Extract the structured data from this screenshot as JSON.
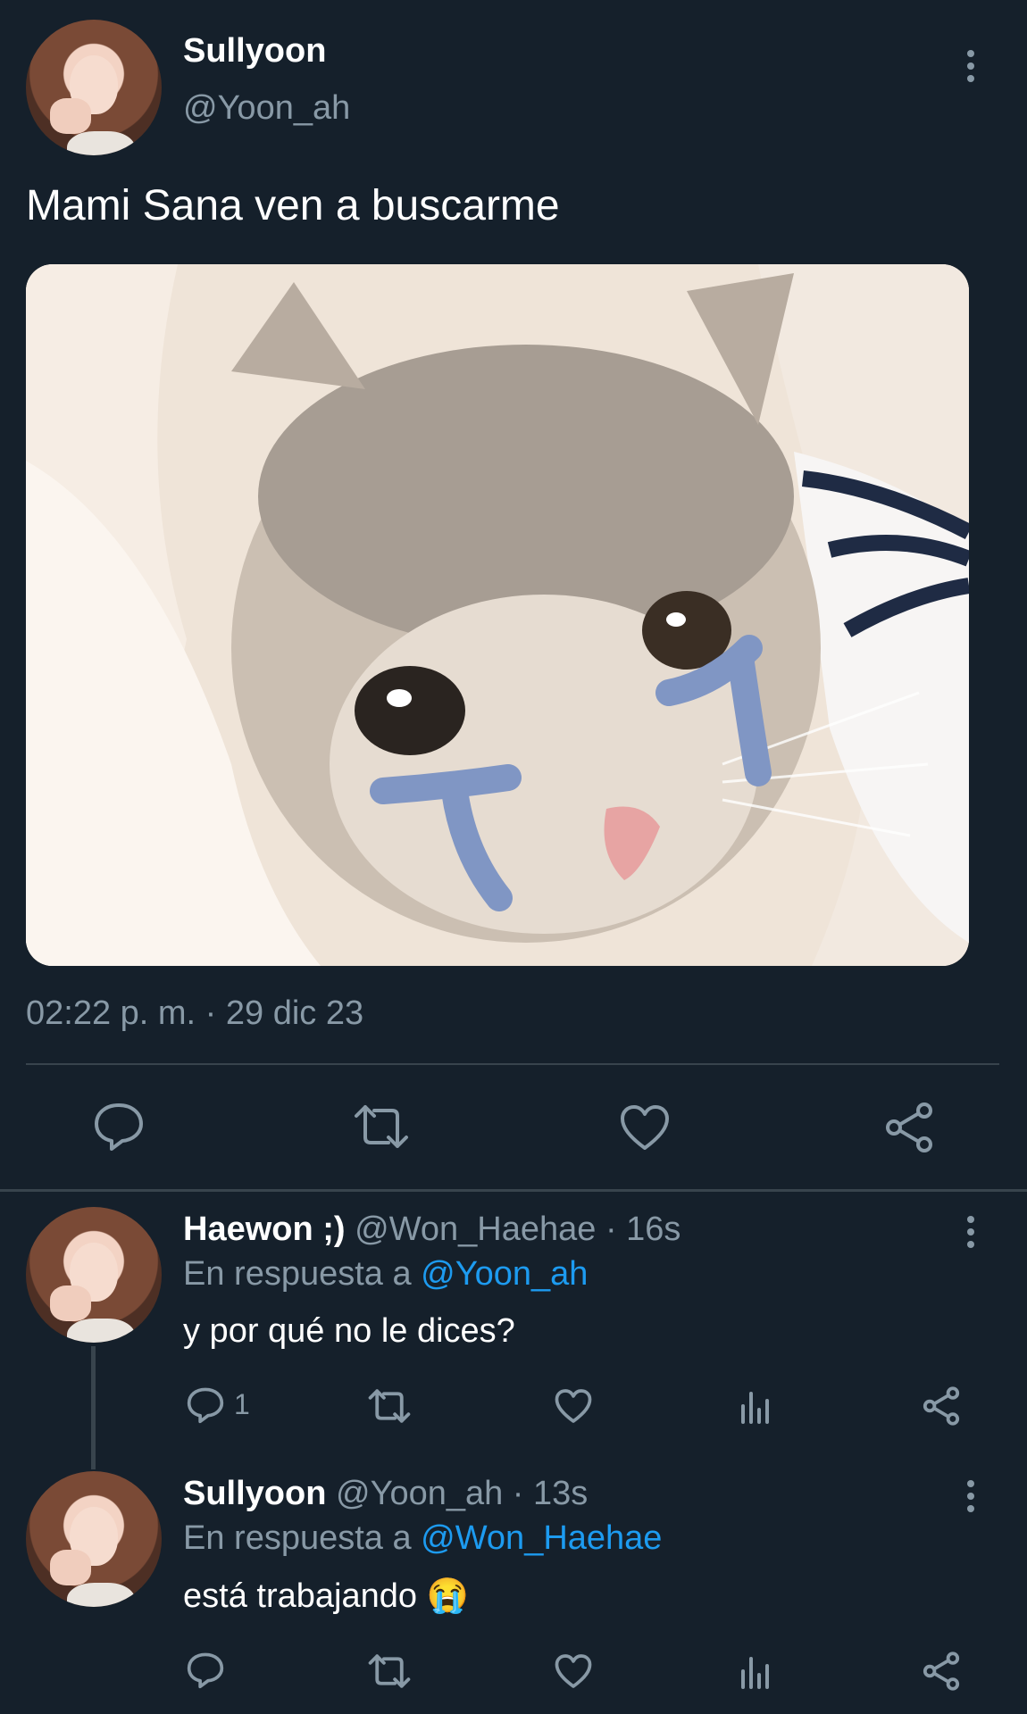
{
  "main_tweet": {
    "display_name": "Sullyoon",
    "handle": "@Yoon_ah",
    "text": "Mami Sana ven a buscarme",
    "timestamp": "02:22 p. m. · 29 dic 23"
  },
  "replies": [
    {
      "display_name": "Haewon ;)",
      "handle_time": "@Won_Haehae · 16s",
      "reply_prefix": "En respuesta a",
      "reply_to": "@Yoon_ah",
      "text": "y por qué no le dices?",
      "reply_count": "1"
    },
    {
      "display_name": "Sullyoon",
      "handle_time": "@Yoon_ah · 13s",
      "reply_prefix": "En respuesta a",
      "reply_to": "@Won_Haehae",
      "text": "está trabajando 😭",
      "reply_count": ""
    }
  ],
  "colors": {
    "background": "#15202b",
    "muted": "#8899a6",
    "link": "#1d9bf0",
    "divider": "#38444d"
  }
}
